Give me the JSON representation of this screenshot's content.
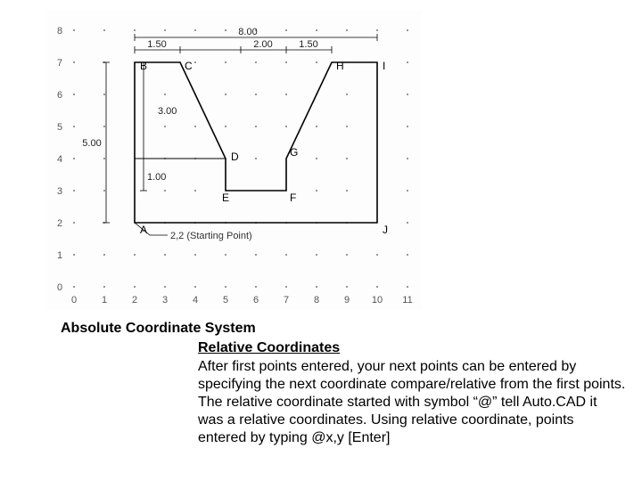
{
  "caption": "Absolute Coordinate System",
  "subhead": "Relative Coordinates",
  "body": "After first points entered, your next points can be entered by specifying the next coordinate compare/relative from the first points. The relative coordinate started with symbol “@” tell Auto.CAD it was a relative coordinates. Using relative coordinate, points entered by typing @x,y [Enter]",
  "axis": {
    "x": [
      "0",
      "1",
      "2",
      "3",
      "4",
      "5",
      "6",
      "7",
      "8",
      "9",
      "10",
      "11"
    ],
    "y": [
      "0",
      "1",
      "2",
      "3",
      "4",
      "5",
      "6",
      "7",
      "8"
    ]
  },
  "dims": {
    "top": "8.00",
    "seg1": "1.50",
    "seg2": "2.00",
    "seg3": "1.50",
    "left_outer": "5.00",
    "left_inner": "3.00",
    "small": "1.00"
  },
  "pts": {
    "A": "A",
    "B": "B",
    "C": "C",
    "D": "D",
    "E": "E",
    "F": "F",
    "G": "G",
    "H": "H",
    "I": "I",
    "J": "J"
  },
  "start_note": "2,2 (Starting Point)"
}
